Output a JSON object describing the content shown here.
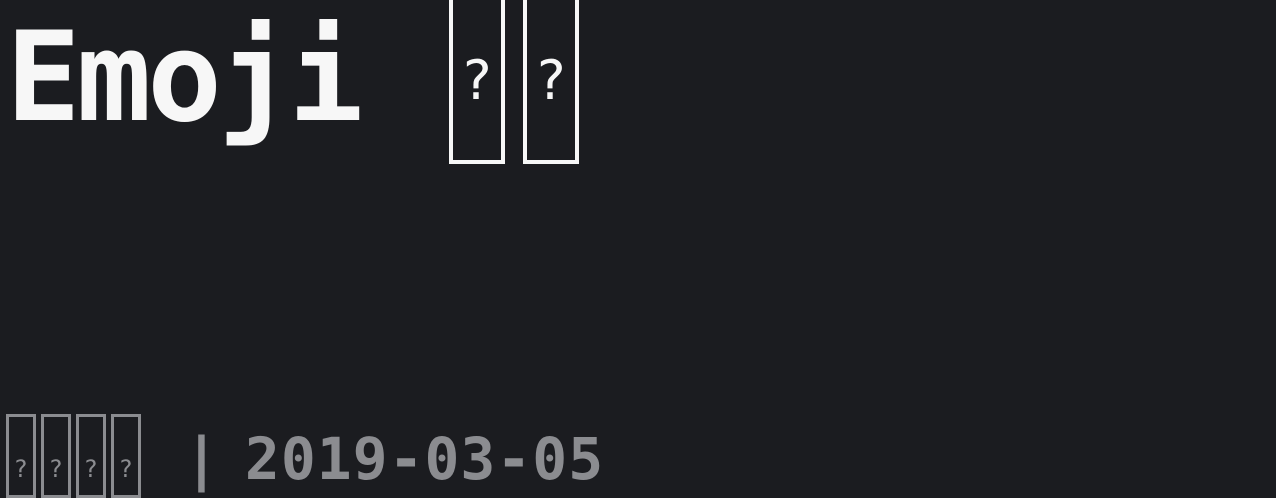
{
  "title": {
    "text": "Emoji",
    "glyphs": [
      "?",
      "?"
    ]
  },
  "meta": {
    "author_glyphs": [
      "?",
      "?",
      "?",
      "?"
    ],
    "separator": "|",
    "date": "2019-03-05"
  },
  "colors": {
    "background": "#1b1c20",
    "title": "#f7f7f7",
    "meta": "#8b8c90"
  }
}
